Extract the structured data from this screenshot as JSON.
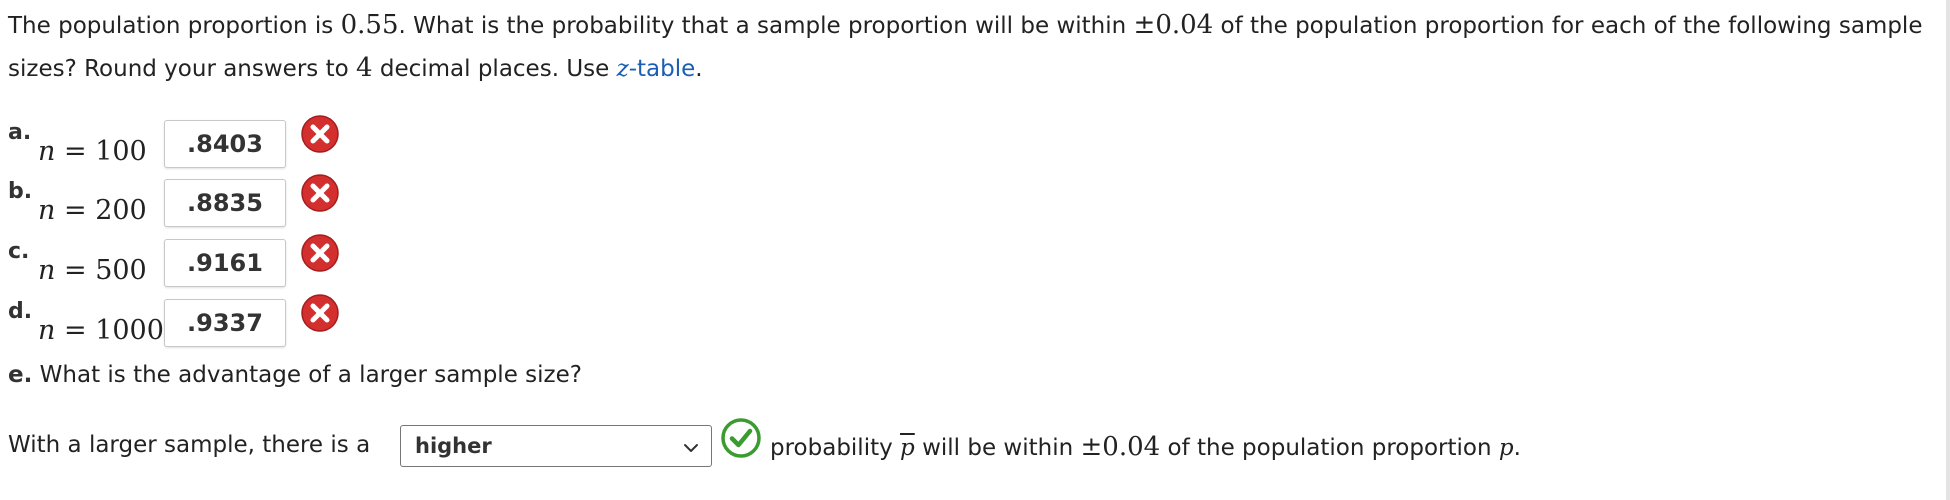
{
  "intro": {
    "text1": "The population proportion is ",
    "p_value": "0.55",
    "text2": ". What is the probability that a sample proportion will be within ",
    "pm_value": "±0.04",
    "text3": " of the population proportion for each of the following sample sizes? Round your answers to ",
    "decimals": "4",
    "text4": " decimal places. Use ",
    "link_var": "z",
    "link_rest": "-table",
    "text5": "."
  },
  "parts": [
    {
      "letter": "a.",
      "n_var": "n",
      "eq": " = ",
      "n_value": "100",
      "answer": ".8403",
      "status": "incorrect"
    },
    {
      "letter": "b.",
      "n_var": "n",
      "eq": " = ",
      "n_value": "200",
      "answer": ".8835",
      "status": "incorrect"
    },
    {
      "letter": "c.",
      "n_var": "n",
      "eq": " = ",
      "n_value": "500",
      "answer": ".9161",
      "status": "incorrect"
    },
    {
      "letter": "d.",
      "n_var": "n",
      "eq": " = ",
      "n_value": "1000",
      "answer": ".9337",
      "status": "incorrect"
    }
  ],
  "part_e": {
    "letter": "e.",
    "question": " What is the advantage of a larger sample size?",
    "prefix": "With a larger sample, there is a ",
    "select_value": "higher",
    "status": "correct",
    "suffix1": " probability ",
    "pbar": "p",
    "suffix2": " will be within ",
    "pm_value": "±0.04",
    "suffix3": " of the population proportion ",
    "p_var": "p",
    "suffix4": "."
  },
  "colors": {
    "incorrect": "#d32f2f",
    "correct": "#3a9b2f",
    "link": "#1a5fb4",
    "text": "#222222"
  },
  "icons": {
    "incorrect": "x-circle-icon",
    "correct": "check-circle-icon",
    "dropdown": "chevron-down-icon"
  }
}
